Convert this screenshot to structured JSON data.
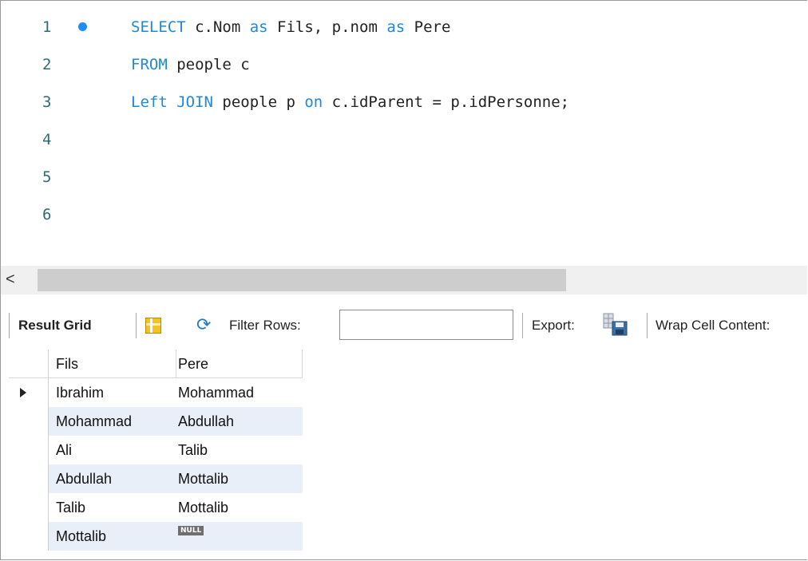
{
  "editor": {
    "lines": [
      {
        "num": "1",
        "tokens": [
          {
            "t": "SELECT",
            "k": true
          },
          {
            "t": " c.Nom ",
            "k": false
          },
          {
            "t": "as",
            "k": true
          },
          {
            "t": " Fils, p.nom ",
            "k": false
          },
          {
            "t": "as",
            "k": true
          },
          {
            "t": " Pere",
            "k": false
          }
        ]
      },
      {
        "num": "2",
        "tokens": [
          {
            "t": "FROM",
            "k": true
          },
          {
            "t": " people c",
            "k": false
          }
        ]
      },
      {
        "num": "3",
        "tokens": [
          {
            "t": "Left JOIN",
            "k": true
          },
          {
            "t": " people p ",
            "k": false
          },
          {
            "t": "on",
            "k": true
          },
          {
            "t": " c.idParent = p.idPersonne;",
            "k": false
          }
        ]
      },
      {
        "num": "4",
        "tokens": []
      },
      {
        "num": "5",
        "tokens": []
      },
      {
        "num": "6",
        "tokens": []
      }
    ]
  },
  "scrollbar": {
    "left_arrow": "<"
  },
  "toolbar": {
    "result_grid": "Result Grid",
    "filter_rows": "Filter Rows:",
    "filter_value": "",
    "export": "Export:",
    "wrap": "Wrap Cell Content:"
  },
  "grid": {
    "columns": [
      "Fils",
      "Pere"
    ],
    "rows": [
      {
        "fils": "Ibrahim",
        "pere": "Mohammad"
      },
      {
        "fils": "Mohammad",
        "pere": "Abdullah"
      },
      {
        "fils": "Ali",
        "pere": "Talib"
      },
      {
        "fils": "Abdullah",
        "pere": "Mottalib"
      },
      {
        "fils": "Talib",
        "pere": "Mottalib"
      },
      {
        "fils": "Mottalib",
        "pere": "NULL"
      }
    ]
  },
  "colors": {
    "keyword": "#1e8ad6",
    "line_number": "#2e6b73",
    "alt_row": "#e8eff8"
  }
}
